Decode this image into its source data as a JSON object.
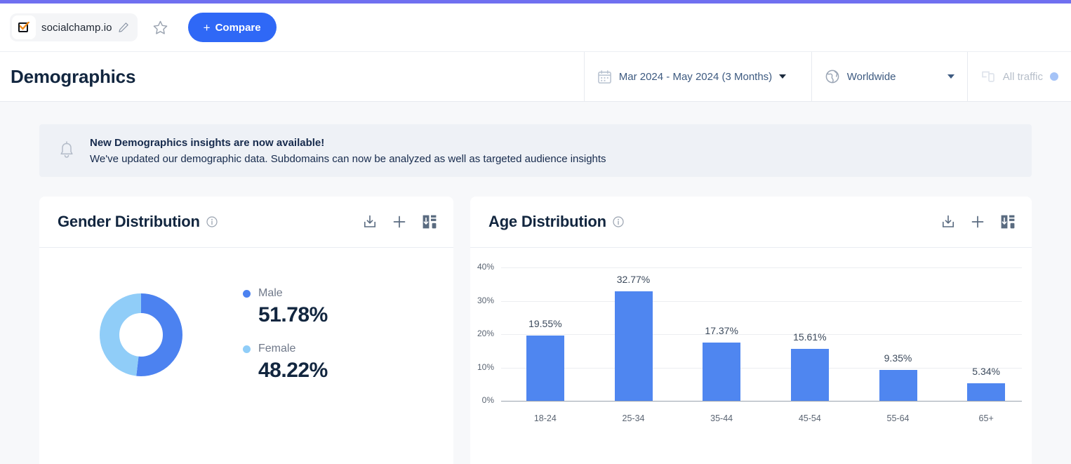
{
  "topbar": {
    "accent_color": "#6f6ff0"
  },
  "domain_bar": {
    "domain": "socialchamp.io",
    "edit_tooltip": "Edit",
    "favorite_tooltip": "Favorite",
    "compare_label": "Compare",
    "compare_plus": "+",
    "compare_color": "#2f68f6"
  },
  "header": {
    "title": "Demographics",
    "filters": {
      "date": "Mar 2024 - May 2024 (3 Months)",
      "geo": "Worldwide",
      "traffic": "All traffic"
    }
  },
  "banner": {
    "title": "New Demographics insights are now available!",
    "subtitle": "We've updated our demographic data. Subdomains can now be analyzed as well as targeted audience insights"
  },
  "gender_card": {
    "title": "Gender Distribution",
    "icons": [
      "export-icon",
      "add-icon",
      "sort-export-icon"
    ]
  },
  "age_card": {
    "title": "Age Distribution",
    "icons": [
      "export-icon",
      "add-icon",
      "sort-export-icon"
    ]
  },
  "chart_data": [
    {
      "type": "pie",
      "title": "Gender Distribution",
      "labels": [
        "Male",
        "Female"
      ],
      "values": [
        51.78,
        48.22
      ],
      "value_labels": [
        "51.78%",
        "48.22%"
      ],
      "colors": [
        "#4c82f0",
        "#90cdf8"
      ],
      "legend": "right",
      "donut": true
    },
    {
      "type": "bar",
      "title": "Age Distribution",
      "categories": [
        "18-24",
        "25-34",
        "35-44",
        "45-54",
        "55-64",
        "65+"
      ],
      "values": [
        19.55,
        32.77,
        17.37,
        15.61,
        9.35,
        5.34
      ],
      "value_labels": [
        "19.55%",
        "32.77%",
        "17.37%",
        "15.61%",
        "9.35%",
        "5.34%"
      ],
      "ytick_labels": [
        "0%",
        "10%",
        "20%",
        "30%",
        "40%"
      ],
      "yticks": [
        0,
        10,
        20,
        30,
        40
      ],
      "ylim": [
        0,
        40
      ],
      "xlabel": "",
      "ylabel": "",
      "grid": true,
      "bar_color": "#4f86f0"
    }
  ]
}
